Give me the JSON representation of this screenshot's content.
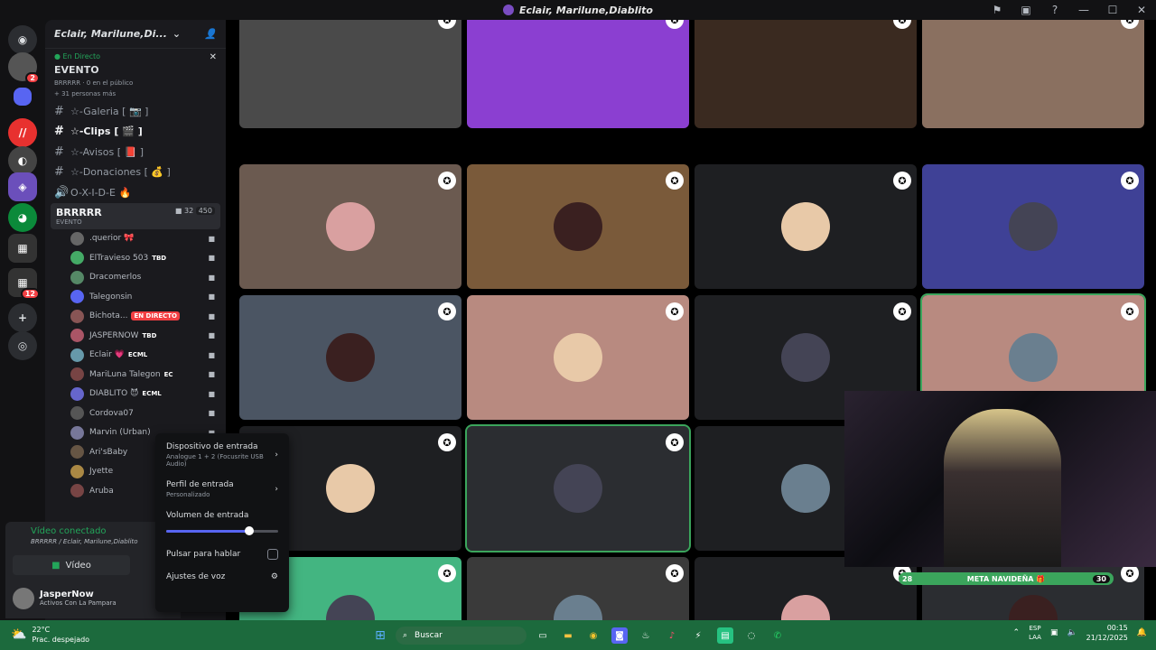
{
  "window": {
    "title": "Eclair, Marilune,Diablito"
  },
  "sidebar": {
    "servers": [
      {
        "badge": "2"
      },
      {
        "badge": "12"
      }
    ],
    "server_name": "Eclair, Marilune,Di...",
    "live_label": "En Directo",
    "event_title": "EVENTO",
    "event_sub": "BRRRRR · 0 en el público",
    "event_sub2": "+ 31 personas más",
    "channels": [
      {
        "name": "☆-Galeria",
        "suffix": "[ 📷 ]"
      },
      {
        "name": "☆-Clips",
        "suffix": "[ 🎬 ]"
      },
      {
        "name": "☆-Avisos",
        "suffix": "[ 📕 ]"
      },
      {
        "name": "☆-Donaciones",
        "suffix": "[ 💰 ]"
      },
      {
        "name": "O-X-I-D-E",
        "suffix": "🔥"
      }
    ],
    "voice_channel": {
      "name": "BRRRRR",
      "count": "32",
      "limit": "450",
      "event": "EVENTO"
    },
    "voice_users": [
      {
        "name": ".querior 🎀",
        "tag": ""
      },
      {
        "name": "ElTravieso 503",
        "tag": "TBD"
      },
      {
        "name": "Dracomerlos",
        "tag": ""
      },
      {
        "name": "Talegonsin",
        "tag": ""
      },
      {
        "name": "Bichota...",
        "tag": "EN DIRECTO"
      },
      {
        "name": "JASPERNOW",
        "tag": "TBD"
      },
      {
        "name": "Eclair 💗",
        "tag": "ECML"
      },
      {
        "name": "MariLuna Talegon",
        "tag": "EC"
      },
      {
        "name": "DIABLITO 😈",
        "tag": "ECML"
      },
      {
        "name": "Cordova07",
        "tag": ""
      },
      {
        "name": "Marvin (Urban)",
        "tag": ""
      },
      {
        "name": "Ari'sBaby",
        "tag": ""
      },
      {
        "name": "Jyette",
        "tag": ""
      },
      {
        "name": "Aruba",
        "tag": ""
      }
    ]
  },
  "voice_panel": {
    "status": "Vídeo conectado",
    "location": "BRRRRR / Eclair, Marilune,Diablito",
    "video_button": "Vídeo"
  },
  "user": {
    "name": "JasperNow",
    "status": "Activos Con La Pampara"
  },
  "popup": {
    "input_device": "Dispositivo de entrada",
    "input_device_value": "Analogue 1 + 2 (Focusrite USB Audio)",
    "input_profile": "Perfil de entrada",
    "input_profile_value": "Personalizado",
    "input_volume": "Volumen de entrada",
    "volume_percent": 74,
    "push_to_talk": "Pulsar para hablar",
    "voice_settings": "Ajustes de voz"
  },
  "stream": {
    "goal": "META NAVIDEÑA 🎁",
    "goal_left": "28",
    "goal_right": "30"
  },
  "colors": {
    "accent": "#5865f2",
    "green": "#23a55a",
    "red": "#f23f43",
    "taskbar": "#1c6a3d"
  },
  "taskbar": {
    "temp": "22°C",
    "weather": "Prac. despejado",
    "search": "Buscar",
    "lang1": "ESP",
    "lang2": "LAA",
    "time": "00:15",
    "date": "21/12/2025"
  }
}
